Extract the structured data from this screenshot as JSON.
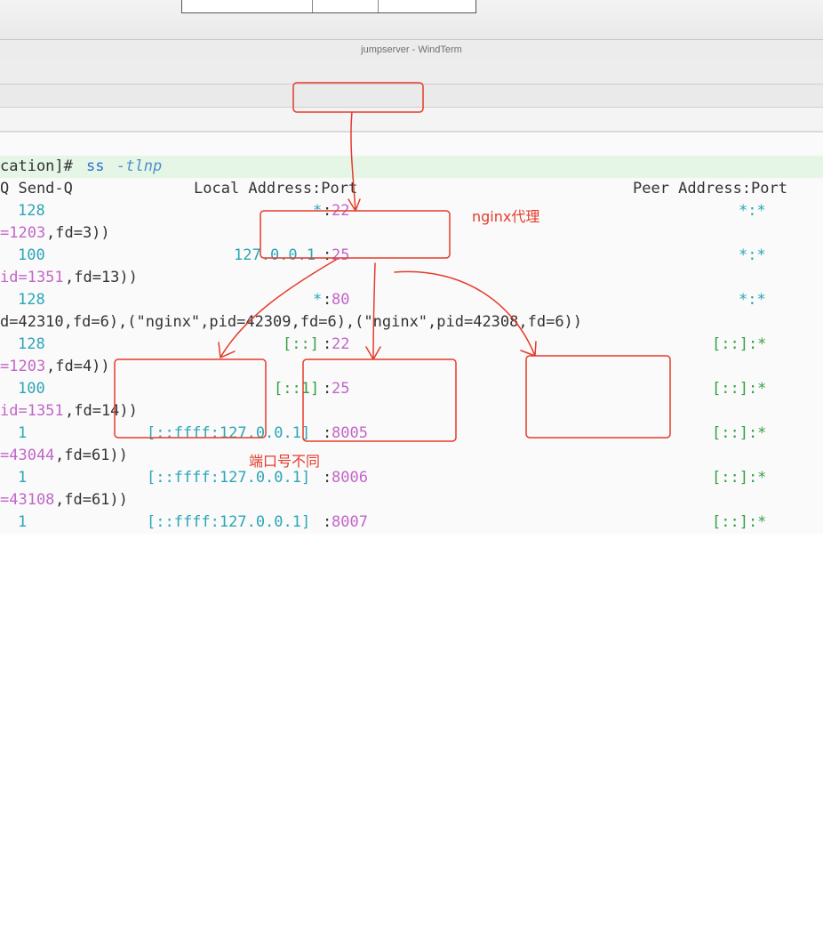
{
  "window": {
    "title": "jumpserver - WindTerm"
  },
  "terminal": {
    "prompt_tail": "cation]# ",
    "command": "ss",
    "command_args": "-tlnp",
    "header": {
      "col1": "Q Send-Q",
      "col2": "Local Address:Port",
      "col3": "Peer Address:Port"
    },
    "rows": {
      "r1": {
        "sendq": "128",
        "local_a": "*",
        "local_b": "22",
        "peer": "*:*",
        "proc_a": "=1203",
        "proc_b": ",fd=3))"
      },
      "r2": {
        "sendq": "100",
        "local_a": "127.0.0.1",
        "local_b": "25",
        "peer": "*:*",
        "proc_a": "id=1351",
        "proc_b": ",fd=13))"
      },
      "r3": {
        "sendq": "128",
        "local_a": "*",
        "local_b": "80",
        "peer": "*:*",
        "proc_text": "d=42310,fd=6),(\"nginx\",pid=42309,fd=6),(\"nginx\",pid=42308,fd=6))"
      },
      "r4": {
        "sendq": "128",
        "local_a": "[::]",
        "local_b": "22",
        "peer": "[::]:*",
        "proc_a": "=1203",
        "proc_b": ",fd=4))"
      },
      "r5": {
        "sendq": "100",
        "local_a": "[::1]",
        "local_b": "25",
        "peer": "[::]:*",
        "proc_a": "id=1351",
        "proc_b": ",fd=14))"
      },
      "r6": {
        "sendq": "1",
        "local_a": "[::ffff:127.0.0.1]",
        "local_b": "8005",
        "peer": "[::]:*",
        "proc_a": "=43044",
        "proc_b": ",fd=61))"
      },
      "r7": {
        "sendq": "1",
        "local_a": "[::ffff:127.0.0.1]",
        "local_b": "8006",
        "peer": "[::]:*",
        "proc_a": "=43108",
        "proc_b": ",fd=61))"
      },
      "r8": {
        "sendq": "1",
        "local_a": "[::ffff:127.0.0.1]",
        "local_b": "8007",
        "peer": "[::]:*"
      }
    }
  },
  "annotations": {
    "nginx_proxy": "nginx代理",
    "ports_differ": "端口号不同"
  },
  "colors": {
    "annotation": "#e53b2b",
    "prompt_highlight": "#e6f6e6",
    "cyan": "#2aa6b8",
    "magenta": "#c266c8"
  }
}
